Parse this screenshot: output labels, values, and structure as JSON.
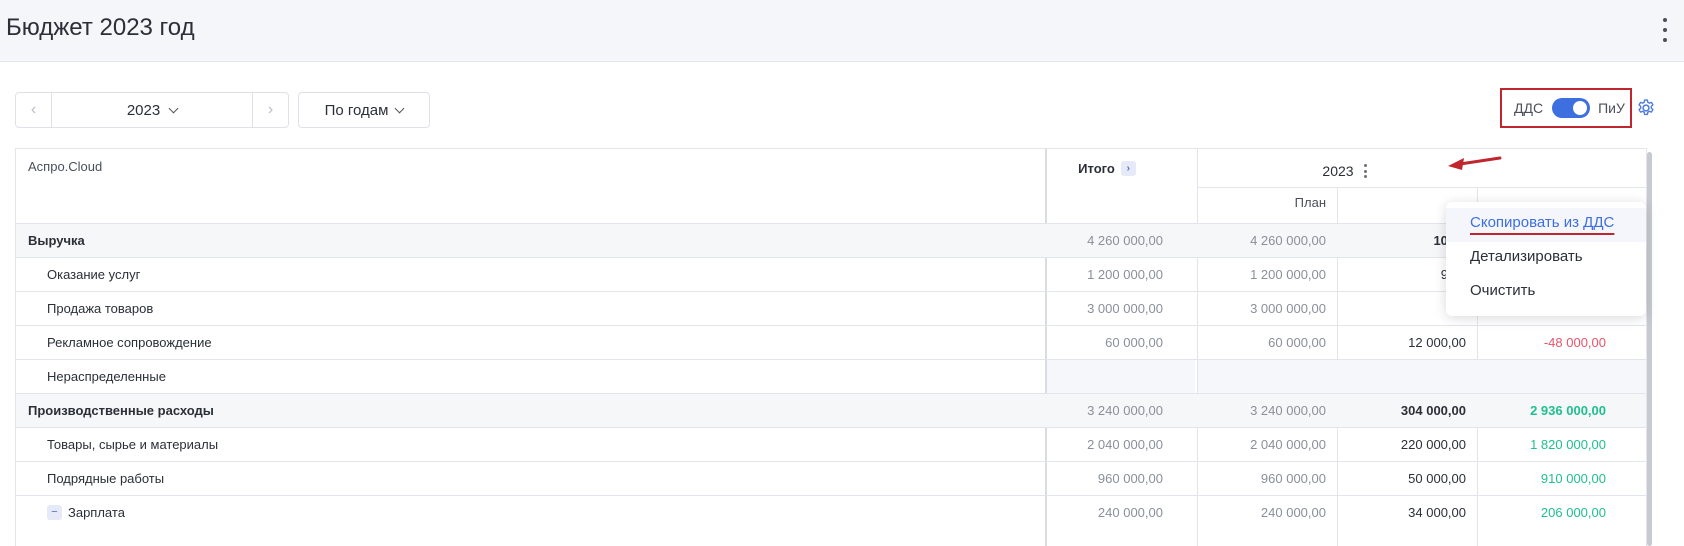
{
  "page": {
    "title": "Бюджет 2023 год"
  },
  "toolbar": {
    "year_value": "2023",
    "period_value": "По годам",
    "toggle_left": "ДДС",
    "toggle_right": "ПиУ"
  },
  "table": {
    "company": "Аспро.Cloud",
    "total_header": "Итого",
    "year_header": "2023",
    "plan_header": "План",
    "rows": [
      {
        "label": "Выручка",
        "total": "4 260 000,00",
        "plan": "4 260 000,00",
        "fact": "102 0",
        "diff": ""
      },
      {
        "label": "Оказание услуг",
        "total": "1 200 000,00",
        "plan": "1 200 000,00",
        "fact": "90 0",
        "diff": ""
      },
      {
        "label": "Продажа товаров",
        "total": "3 000 000,00",
        "plan": "3 000 000,00",
        "fact": "",
        "diff": ""
      },
      {
        "label": "Рекламное сопровождение",
        "total": "60 000,00",
        "plan": "60 000,00",
        "fact": "12 000,00",
        "diff": "-48 000,00"
      },
      {
        "label": "Нераспределенные",
        "total": "",
        "plan": "",
        "fact": "",
        "diff": ""
      },
      {
        "label": "Производственные расходы",
        "total": "3 240 000,00",
        "plan": "3 240 000,00",
        "fact": "304 000,00",
        "diff": "2 936 000,00"
      },
      {
        "label": "Товары, сырье и материалы",
        "total": "2 040 000,00",
        "plan": "2 040 000,00",
        "fact": "220 000,00",
        "diff": "1 820 000,00"
      },
      {
        "label": "Подрядные работы",
        "total": "960 000,00",
        "plan": "960 000,00",
        "fact": "50 000,00",
        "diff": "910 000,00"
      },
      {
        "label": "Зарплата",
        "total": "240 000,00",
        "plan": "240 000,00",
        "fact": "34 000,00",
        "diff": "206 000,00"
      }
    ]
  },
  "context_menu": {
    "items": [
      "Скопировать из ДДС",
      "Детализировать",
      "Очистить"
    ]
  },
  "colors": {
    "accent": "#3d6fe0",
    "negative": "#e8536a",
    "positive": "#1fbf8f",
    "annotation": "#c0262d"
  }
}
